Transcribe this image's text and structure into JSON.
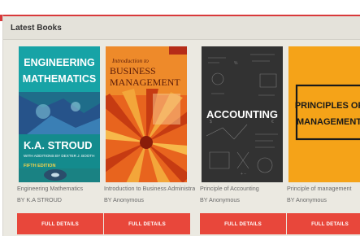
{
  "section": {
    "title": "Latest Books"
  },
  "books": [
    {
      "title": "Engineering Mathematics",
      "author_line": "BY K.A STROUD",
      "button_label": "FULL DETAILS",
      "cover": {
        "line1": "ENGINEERING",
        "line2": "MATHEMATICS",
        "author": "K.A. STROUD",
        "subtitle": "WITH ADDITIONS BY DEXTER J. BOOTH",
        "edition": "FIFTH EDITION",
        "color": "#1a9a9a"
      }
    },
    {
      "title": "Introduction to Business Administration",
      "author_line": "BY Anonymous",
      "button_label": "FULL DETAILS",
      "cover": {
        "line1": "Introduction to",
        "line2": "BUSINESS",
        "line3": "MANAGEMENT",
        "color": "#e8641e"
      }
    },
    {
      "title": "Principle of Accounting",
      "author_line": "BY Anonymous",
      "button_label": "FULL DETAILS",
      "cover": {
        "line1": "ACCOUNTING",
        "color": "#2e2e2e"
      }
    },
    {
      "title": "Principle of management",
      "author_line": "BY Anonymous",
      "button_label": "FULL DETAILS",
      "cover": {
        "line1": "PRINCIPLES OF",
        "line2": "MANAGEMENT",
        "color": "#f5a318"
      }
    }
  ]
}
